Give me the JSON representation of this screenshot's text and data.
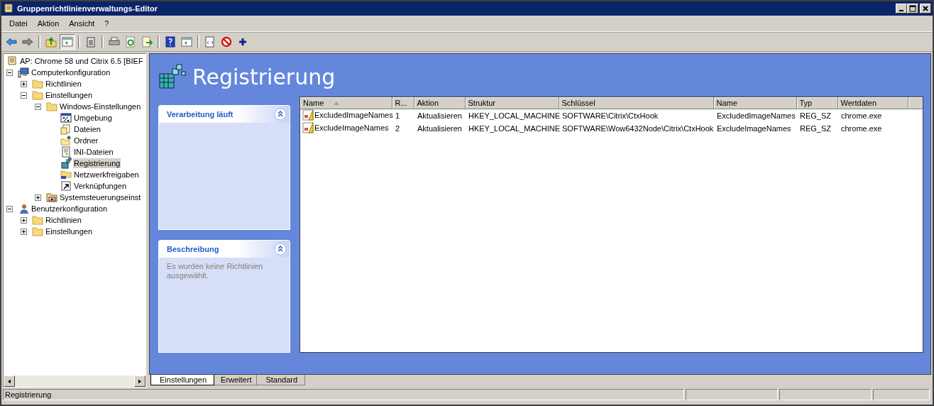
{
  "window": {
    "title": "Gruppenrichtlinienverwaltungs-Editor"
  },
  "menu": [
    "Datei",
    "Aktion",
    "Ansicht",
    "?"
  ],
  "toolbar": [
    [
      {
        "kind": "back",
        "pressed": false
      },
      {
        "kind": "forward",
        "pressed": false
      }
    ],
    [
      {
        "kind": "up",
        "pressed": false
      },
      {
        "kind": "tree",
        "pressed": true
      }
    ],
    [
      {
        "kind": "clipboard",
        "pressed": false
      }
    ],
    [
      {
        "kind": "print",
        "pressed": false
      },
      {
        "kind": "refresh",
        "pressed": false
      },
      {
        "kind": "export",
        "pressed": false
      }
    ],
    [
      {
        "kind": "help",
        "pressed": false
      },
      {
        "kind": "action",
        "pressed": false
      }
    ],
    [
      {
        "kind": "doc",
        "pressed": false
      },
      {
        "kind": "stop",
        "pressed": false
      },
      {
        "kind": "plus",
        "pressed": false
      }
    ]
  ],
  "tree": [
    {
      "label": "AP: Chrome 58 und Citrix 6.5 [BIEF",
      "kind": "scroll",
      "selected": false
    },
    {
      "label": "Computerkonfiguration",
      "kind": "computer",
      "expanded": true,
      "selected": false,
      "children": [
        {
          "label": "Richtlinien",
          "kind": "folder",
          "expanded": false,
          "selected": false
        },
        {
          "label": "Einstellungen",
          "kind": "folder",
          "expanded": true,
          "selected": false,
          "children": [
            {
              "label": "Windows-Einstellungen",
              "kind": "folder",
              "expanded": true,
              "selected": false,
              "children": [
                {
                  "label": "Umgebung",
                  "kind": "percent",
                  "selected": false
                },
                {
                  "label": "Dateien",
                  "kind": "files",
                  "selected": false
                },
                {
                  "label": "Ordner",
                  "kind": "newfolder",
                  "selected": false
                },
                {
                  "label": "INI-Dateien",
                  "kind": "ini",
                  "selected": false
                },
                {
                  "label": "Registrierung",
                  "kind": "registry",
                  "selected": true
                },
                {
                  "label": "Netzwerkfreigaben",
                  "kind": "share",
                  "selected": false
                },
                {
                  "label": "Verknüpfungen",
                  "kind": "shortcut",
                  "selected": false
                }
              ]
            },
            {
              "label": "Systemsteuerungseinst",
              "kind": "controlfolder",
              "expanded": false,
              "selected": false
            }
          ]
        }
      ]
    },
    {
      "label": "Benutzerkonfiguration",
      "kind": "user",
      "expanded": true,
      "selected": false,
      "children": [
        {
          "label": "Richtlinien",
          "kind": "folder",
          "expanded": false,
          "selected": false
        },
        {
          "label": "Einstellungen",
          "kind": "folder",
          "expanded": false,
          "selected": false
        }
      ]
    }
  ],
  "heading": "Registrierung",
  "cards": [
    {
      "title": "Verarbeitung läuft",
      "expanded": true
    },
    {
      "title": "Beschreibung",
      "expanded": true,
      "text": "Es wurden keine Richtlinien ausgewählt."
    }
  ],
  "table": {
    "columns": [
      {
        "label": "Name",
        "sorted": true
      },
      {
        "label": "R..."
      },
      {
        "label": "Aktion"
      },
      {
        "label": "Struktur"
      },
      {
        "label": "Schlüssel"
      },
      {
        "label": "Name"
      },
      {
        "label": "Typ"
      },
      {
        "label": "Wertdaten"
      }
    ],
    "rows": [
      [
        "ExcludedImageNames",
        "1",
        "Aktualisieren",
        "HKEY_LOCAL_MACHINE",
        "SOFTWARE\\Citrix\\CtxHook",
        "ExcludedImageNames",
        "REG_SZ",
        "chrome.exe"
      ],
      [
        "ExcludeImageNames",
        "2",
        "Aktualisieren",
        "HKEY_LOCAL_MACHINE",
        "SOFTWARE\\Wow6432Node\\Citrix\\CtxHook",
        "ExcludeImageNames",
        "REG_SZ",
        "chrome.exe"
      ]
    ]
  },
  "tabs": [
    {
      "label": "Einstellungen",
      "selected": true
    },
    {
      "label": "Erweitert",
      "selected": false
    },
    {
      "label": "Standard",
      "selected": false
    }
  ],
  "status_bar": {
    "text": "Registrierung"
  }
}
